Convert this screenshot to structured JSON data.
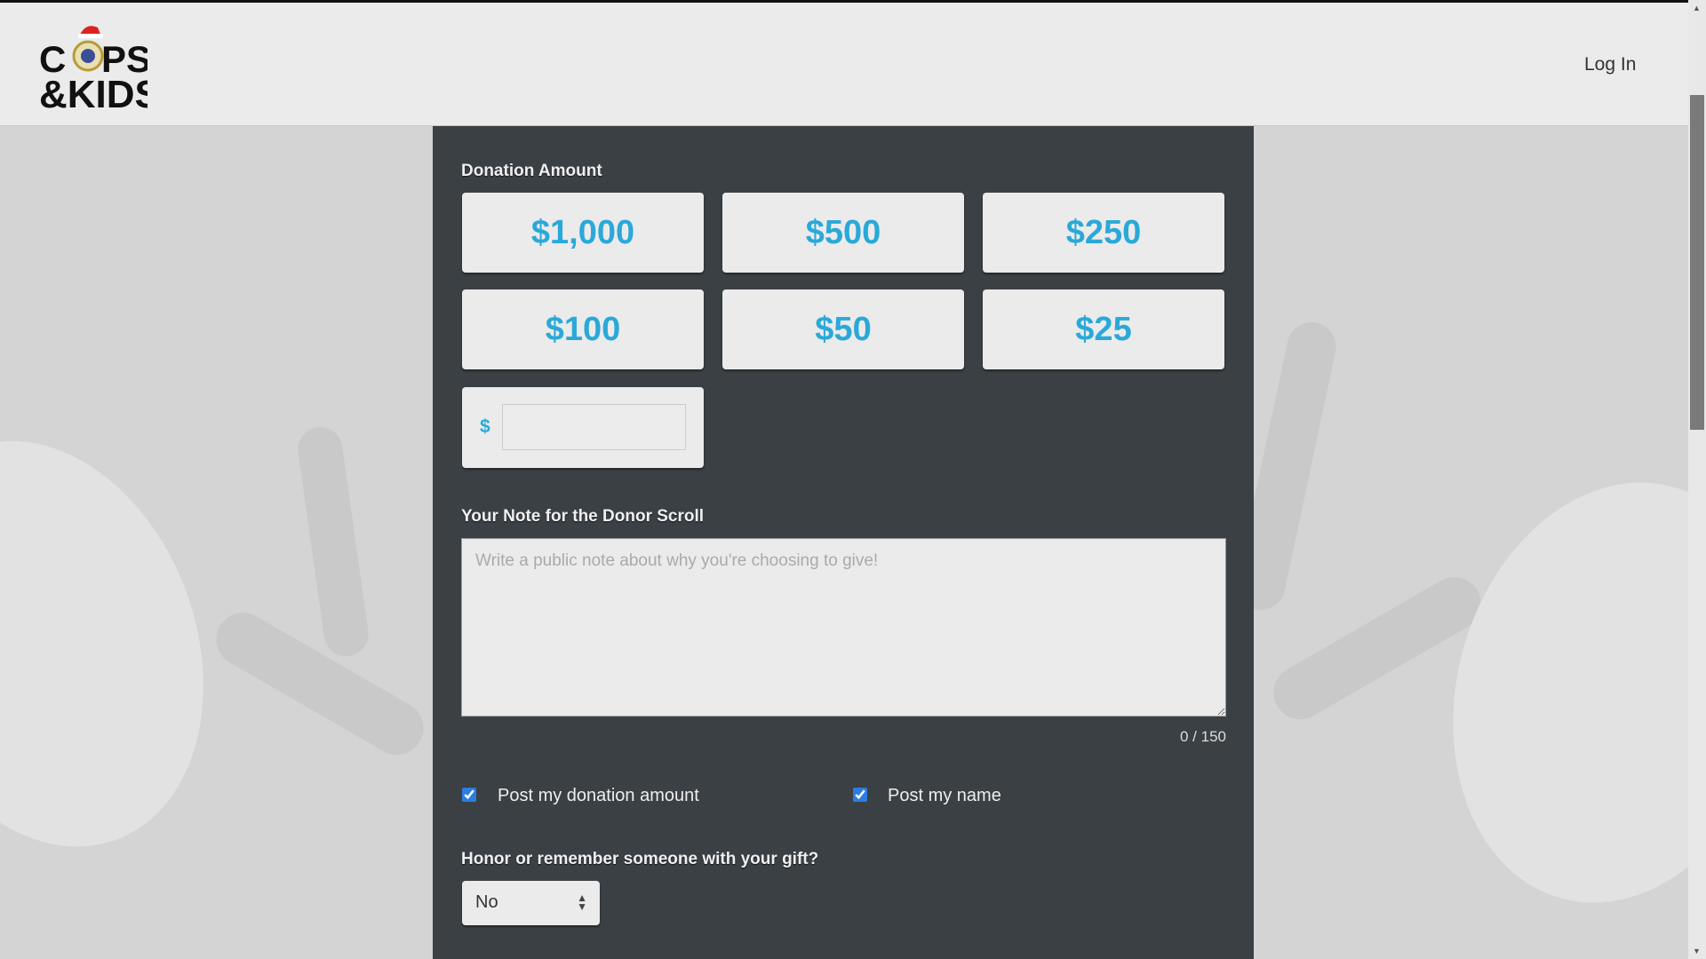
{
  "header": {
    "logo_text": "COPS & KIDS",
    "login_label": "Log In"
  },
  "form": {
    "donation_label": "Donation Amount",
    "amounts": [
      "$1,000",
      "$500",
      "$250",
      "$100",
      "$50",
      "$25"
    ],
    "custom_currency": "$",
    "custom_value": "",
    "note_label": "Your Note for the Donor Scroll",
    "note_placeholder": "Write a public note about why you're choosing to give!",
    "note_value": "",
    "counter": "0 / 150",
    "post_amount_label": "Post my donation amount",
    "post_amount_checked": true,
    "post_name_label": "Post my name",
    "post_name_checked": true,
    "honor_label": "Honor or remember someone with your gift?",
    "honor_selected": "No"
  },
  "colors": {
    "accent": "#2aa9d9",
    "panel": "#3a4044",
    "header": "#ebebeb"
  }
}
